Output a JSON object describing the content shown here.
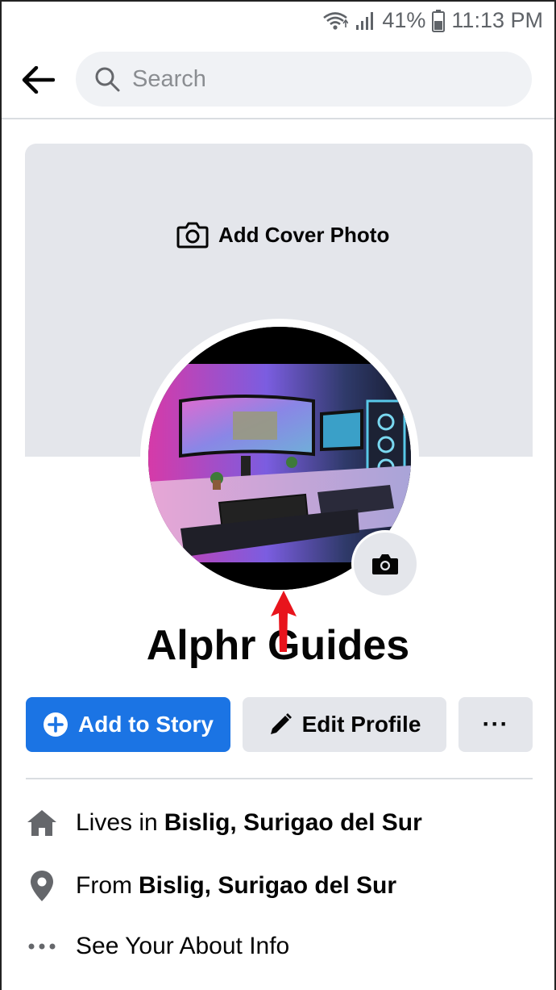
{
  "status_bar": {
    "battery": "41%",
    "time": "11:13 PM"
  },
  "header": {
    "search_placeholder": "Search"
  },
  "cover": {
    "add_cover_label": "Add Cover Photo"
  },
  "profile": {
    "name": "Alphr Guides"
  },
  "actions": {
    "add_story_label": "Add to Story",
    "edit_profile_label": "Edit Profile",
    "more_label": "···"
  },
  "details": {
    "lives_prefix": "Lives in",
    "lives_value": "Bislig, Surigao del Sur",
    "from_prefix": "From",
    "from_value": "Bislig, Surigao del Sur",
    "about_label": "See Your About Info"
  },
  "colors": {
    "accent": "#1b74e4",
    "annotation_arrow": "#e8141c",
    "cover_bg": "#e4e6eb"
  }
}
